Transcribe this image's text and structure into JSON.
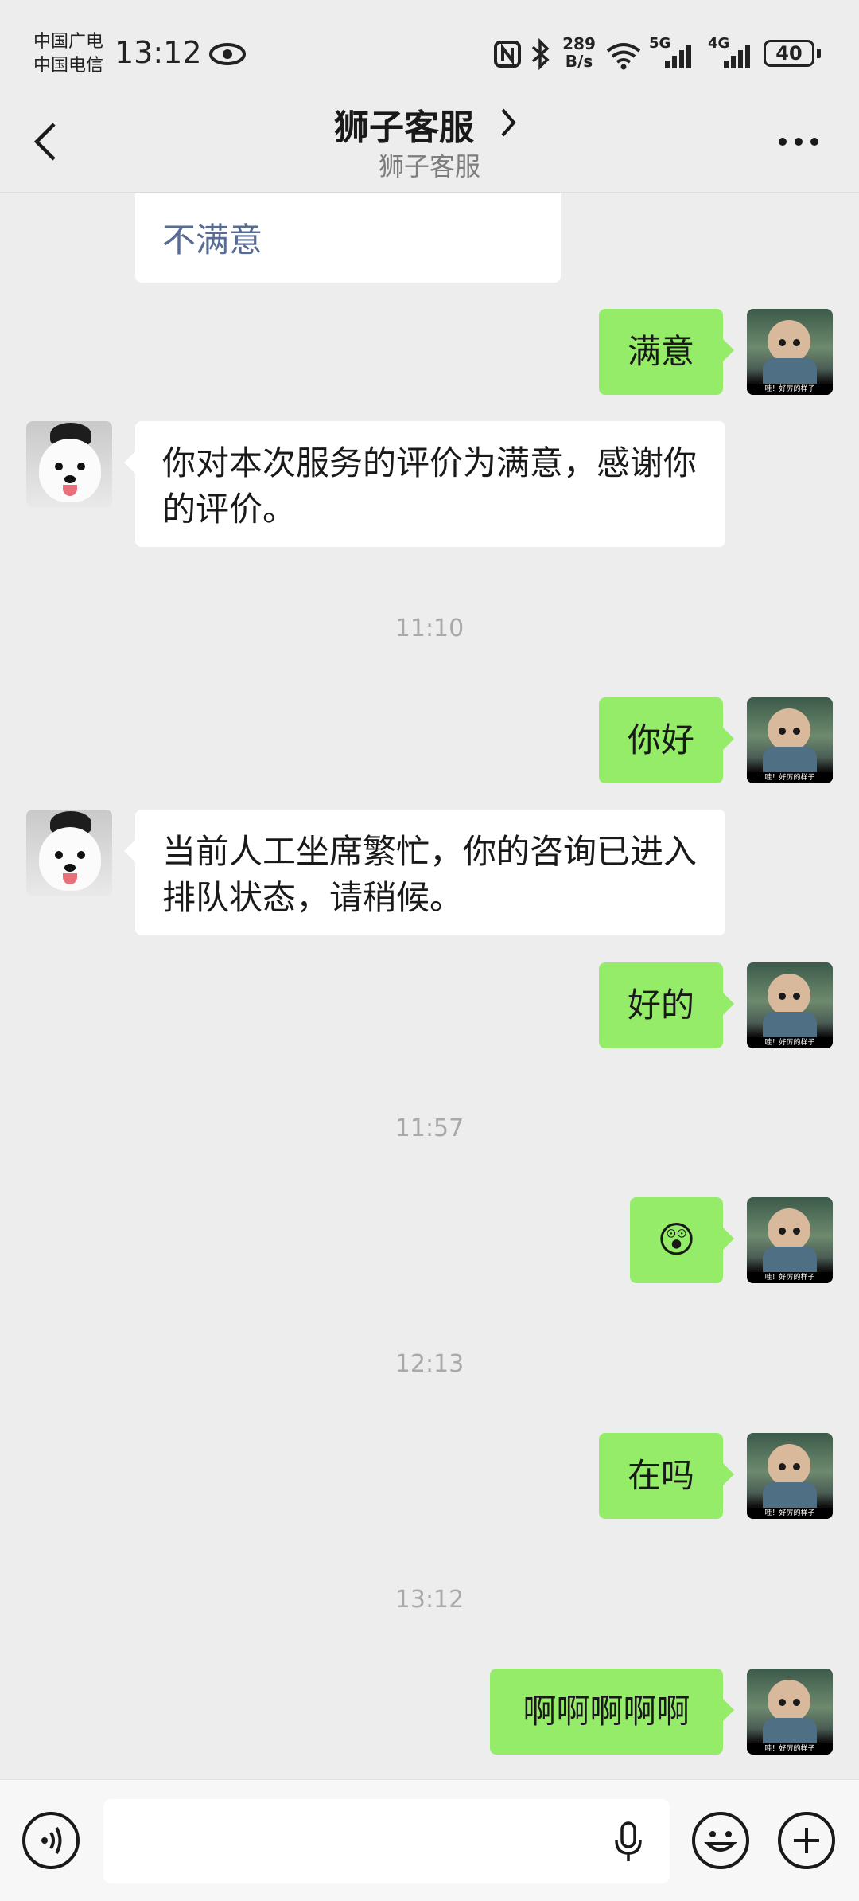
{
  "status_bar": {
    "carrier_1": "中国广电",
    "carrier_2": "中国电信",
    "time": "13:12",
    "net_speed_value": "289",
    "net_speed_unit": "B/s",
    "net_5g": "5G",
    "net_4g": "4G",
    "battery": "40"
  },
  "header": {
    "title": "狮子客服",
    "subtitle": "狮子客服",
    "back_icon": "chevron-left-icon",
    "more_icon": "more-dots-icon"
  },
  "messages": [
    {
      "side": "left",
      "text": "不满意"
    },
    {
      "side": "right",
      "text": "满意"
    },
    {
      "side": "left",
      "text": "你对本次服务的评价为满意，感谢你的评价。"
    },
    {
      "side": "time",
      "text": "11:10"
    },
    {
      "side": "right",
      "text": "你好"
    },
    {
      "side": "left",
      "text": "当前人工坐席繁忙，你的咨询已进入排队状态，请稍候。"
    },
    {
      "side": "right",
      "text": "好的"
    },
    {
      "side": "time",
      "text": "11:57"
    },
    {
      "side": "right",
      "text": "😲"
    },
    {
      "side": "time",
      "text": "12:13"
    },
    {
      "side": "right",
      "text": "在吗"
    },
    {
      "side": "time",
      "text": "13:12"
    },
    {
      "side": "right",
      "text": "啊啊啊啊啊"
    }
  ],
  "avatar_caption": "哇！好厉的样子",
  "input_bar": {
    "voice_icon": "voice-icon",
    "mic_icon": "microphone-icon",
    "emoji_icon": "emoji-icon",
    "plus_icon": "plus-icon",
    "value": ""
  },
  "colors": {
    "background": "#ededed",
    "bubble_me": "#95ec69",
    "bubble_other": "#ffffff",
    "link_text": "#576b95"
  }
}
